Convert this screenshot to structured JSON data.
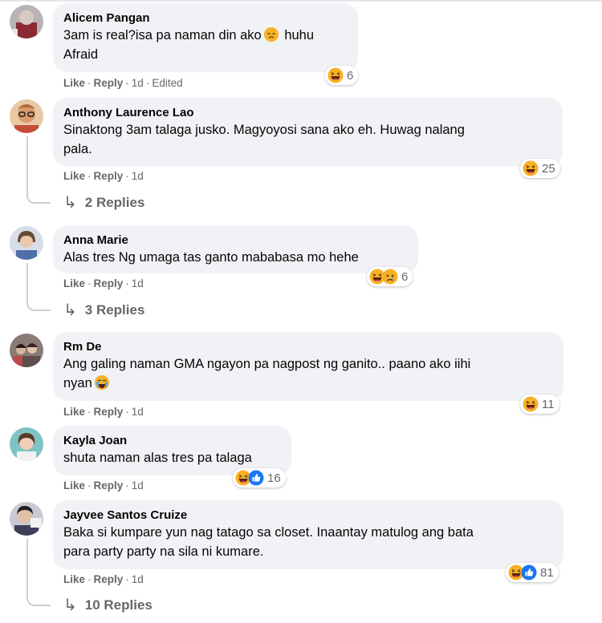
{
  "comments": [
    {
      "author": "Alicem Pangan",
      "text_line1_before": "3am is real?isa pa naman din ako",
      "text_line1_after": " huhu",
      "text_line2": "Afraid",
      "like": "Like",
      "reply": "Reply",
      "time": "1d",
      "edited": "Edited",
      "reaction_count": "6",
      "avatar_color": "#a9a3a8"
    },
    {
      "author": "Anthony Laurence Lao",
      "text_line1": "Sinaktong 3am talaga jusko. Magyoyosi sana ako eh. Huwag nalang",
      "text_line2": "pala.",
      "like": "Like",
      "reply": "Reply",
      "time": "1d",
      "reaction_count": "25",
      "replies_label": "2 Replies",
      "avatar_color": "#c98a52"
    },
    {
      "author": "Anna Marie",
      "text_line1": "Alas tres Ng umaga tas ganto mababasa mo hehe",
      "like": "Like",
      "reply": "Reply",
      "time": "1d",
      "reaction_count": "6",
      "replies_label": "3 Replies",
      "avatar_color": "#8aa2c4"
    },
    {
      "author": "Rm De",
      "text_line1": "Ang galing naman GMA ngayon pa nagpost ng ganito.. paano ako iihi",
      "text_line2": "nyan",
      "like": "Like",
      "reply": "Reply",
      "time": "1d",
      "reaction_count": "11",
      "avatar_color": "#7d6e6a"
    },
    {
      "author": "Kayla Joan",
      "text_line1": "shuta naman alas tres pa talaga",
      "like": "Like",
      "reply": "Reply",
      "time": "1d",
      "reaction_count": "16",
      "avatar_color": "#6fb5b8"
    },
    {
      "author": "Jayvee Santos Cruize",
      "text_line1": "Baka si kumpare yun nag tatago sa closet. Inaantay matulog ang bata",
      "text_line2": "para party party na sila ni kumare.",
      "like": "Like",
      "reply": "Reply",
      "time": "1d",
      "reaction_count": "81",
      "replies_label": "10 Replies",
      "avatar_color": "#9a9aa6"
    }
  ],
  "colors": {
    "bubble": "#f0f2f5",
    "meta_text": "#65676b",
    "haha_yellow": "#f7b125",
    "like_blue": "#1877f2"
  },
  "icons": [
    "haha-icon",
    "sad-icon",
    "crying-icon",
    "like-icon",
    "reply-arrow-icon"
  ]
}
